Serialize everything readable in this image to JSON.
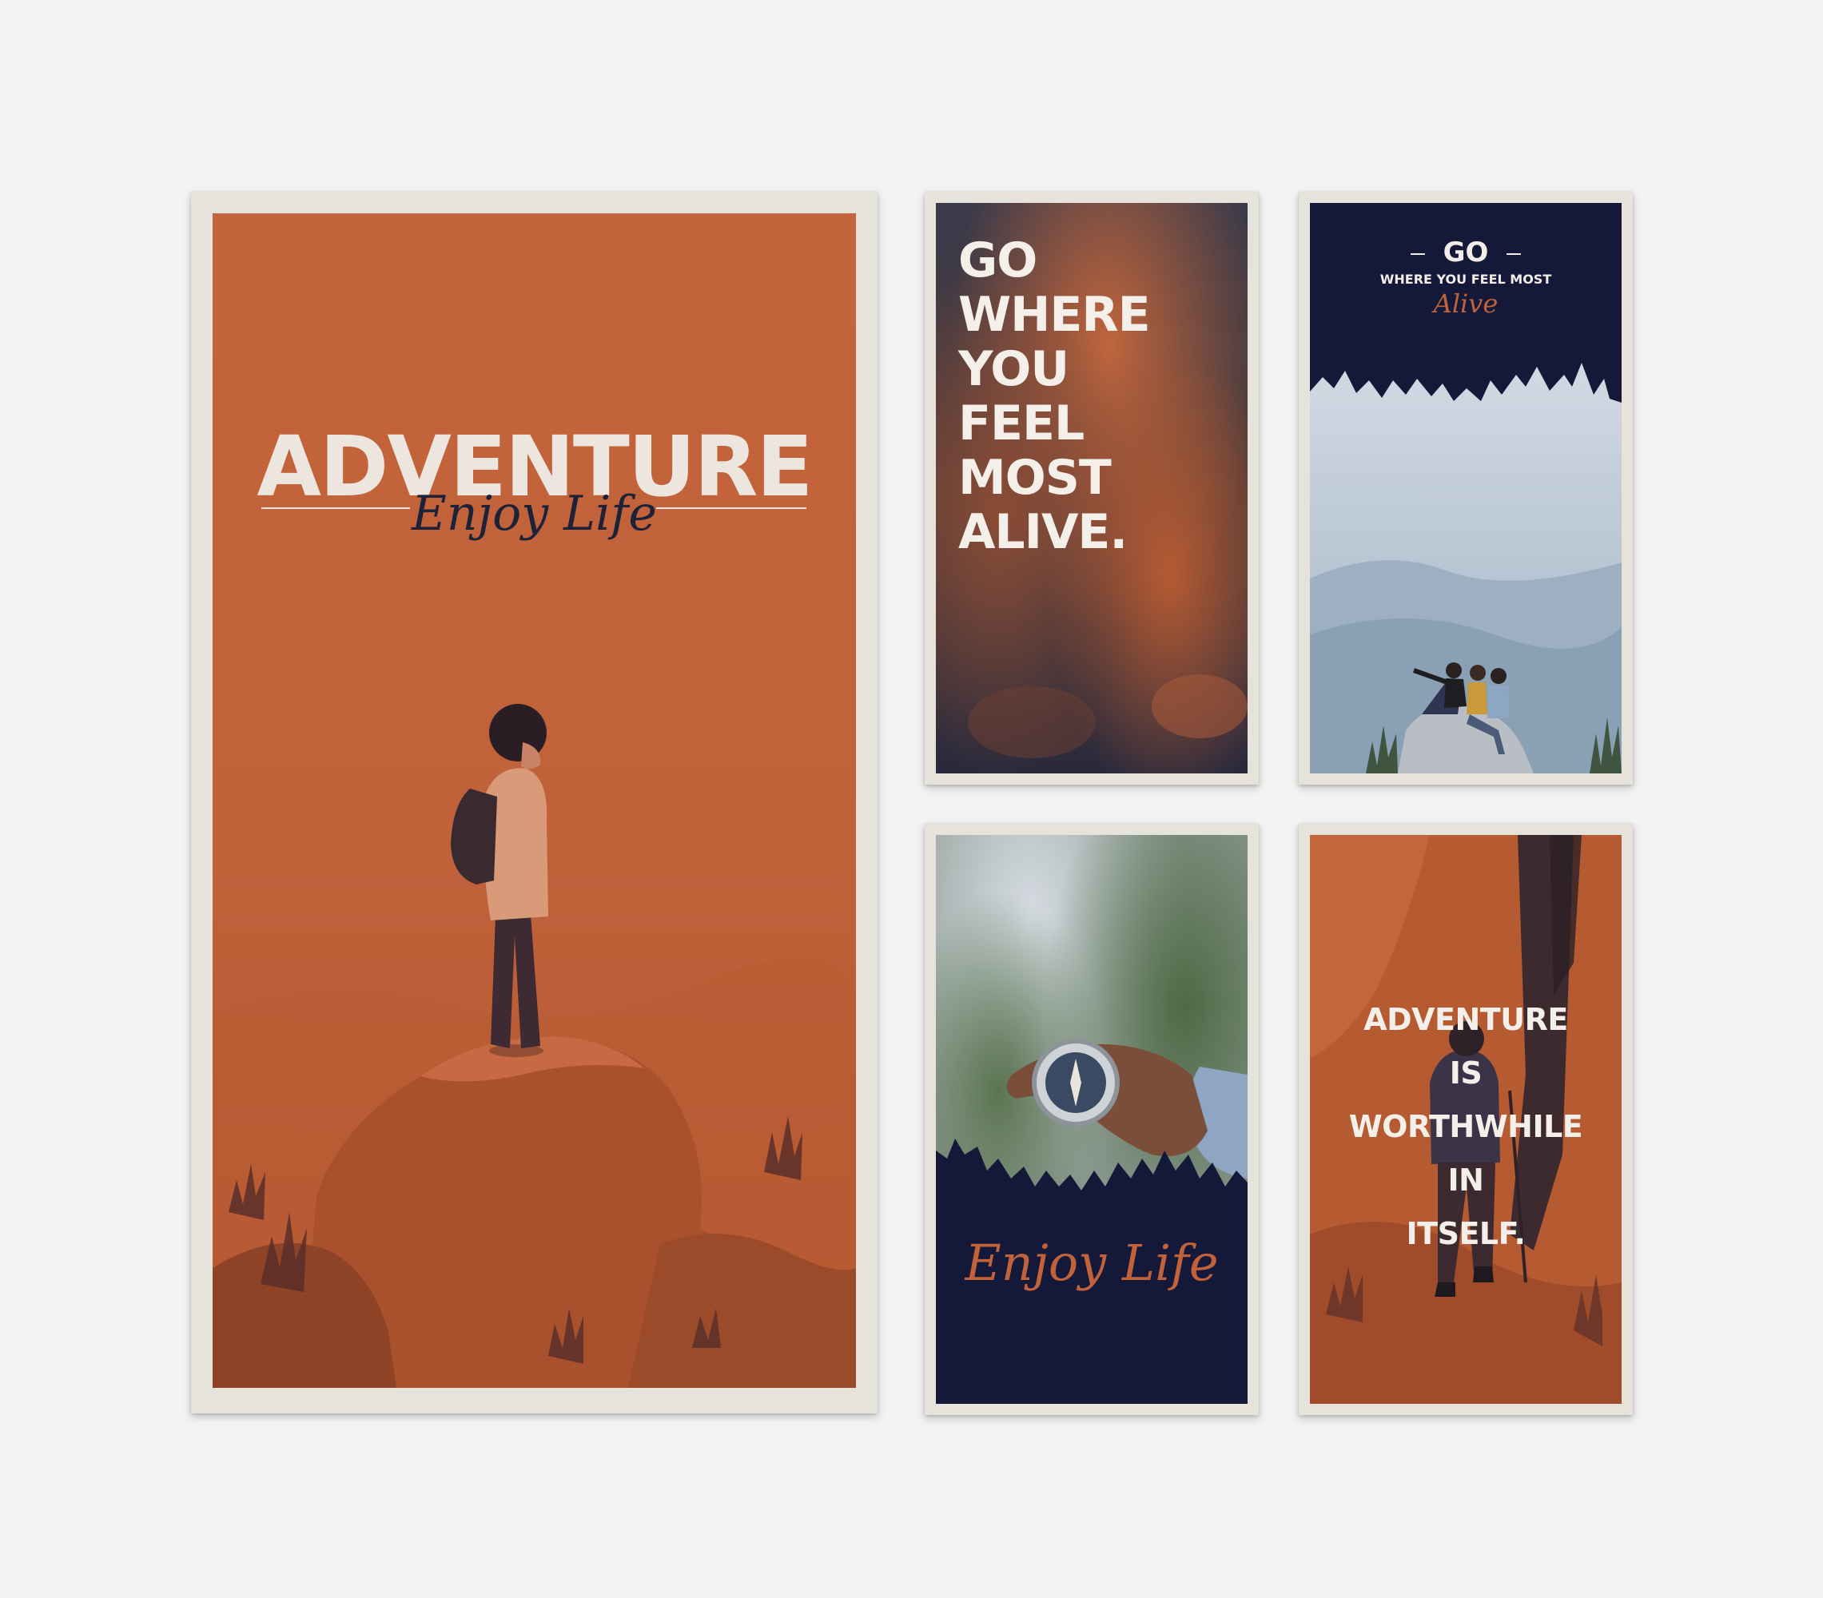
{
  "poster_large": {
    "title": "ADVENTURE",
    "script": "Enjoy Life"
  },
  "poster_go_where": {
    "lines": [
      "GO",
      "WHERE",
      "YOU",
      "FEEL",
      "MOST",
      "ALIVE."
    ]
  },
  "poster_hikers": {
    "title": "GO",
    "subtitle": "WHERE YOU FEEL MOST",
    "script": "Alive"
  },
  "poster_compass": {
    "script": "Enjoy Life"
  },
  "poster_worthwhile": {
    "lines": [
      "ADVENTURE",
      "IS",
      "WORTHWHILE",
      "IN",
      "ITSELF."
    ]
  },
  "colors": {
    "wall": "#f3f3f3",
    "frame": "#e6e2dc",
    "burnt_orange": "#c2623a",
    "navy": "#14193a",
    "cream": "#ece6df"
  }
}
